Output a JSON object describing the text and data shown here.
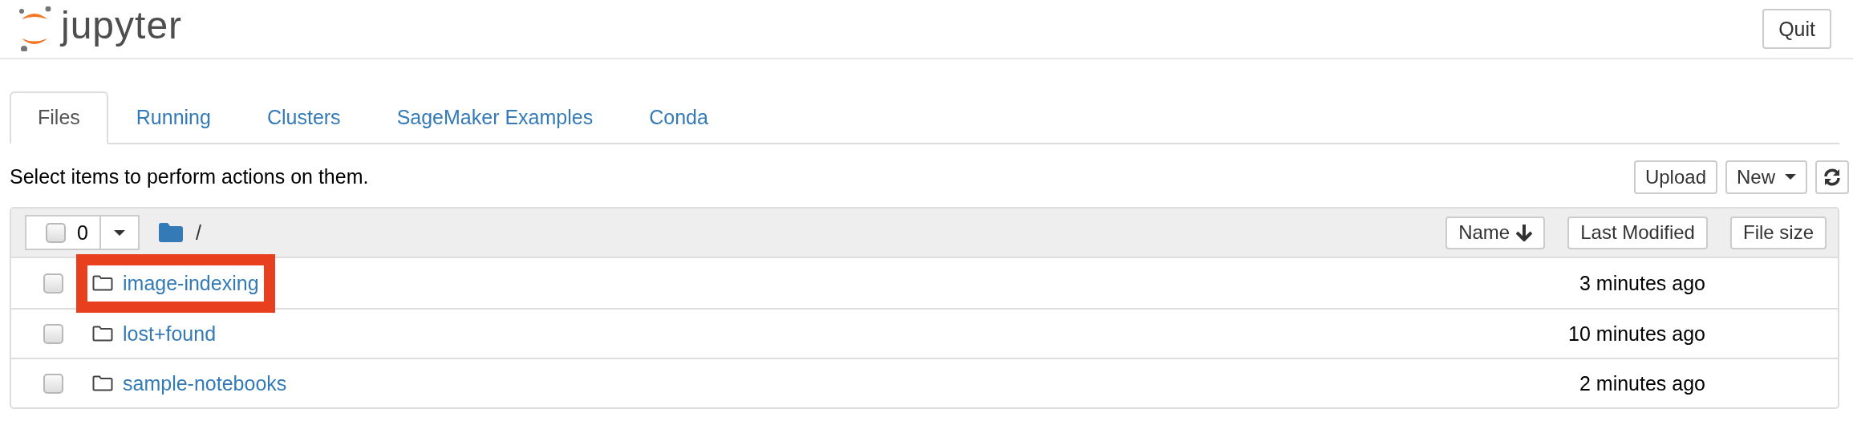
{
  "header": {
    "logo_text": "jupyter",
    "quit_button": "Quit"
  },
  "tabs": [
    {
      "label": "Files",
      "selected": true
    },
    {
      "label": "Running",
      "selected": false
    },
    {
      "label": "Clusters",
      "selected": false
    },
    {
      "label": "SageMaker Examples",
      "selected": false
    },
    {
      "label": "Conda",
      "selected": false
    }
  ],
  "toolbar": {
    "hint": "Select items to perform actions on them.",
    "buttons": [
      {
        "kind": "plain",
        "label": "Upload"
      },
      {
        "kind": "dropdown",
        "label": "New"
      },
      {
        "kind": "refresh"
      }
    ]
  },
  "file_list": {
    "select_all": {
      "checked": false,
      "count": "0"
    },
    "path": "/",
    "columns": [
      {
        "label": "Name",
        "sorted": true
      },
      {
        "label": "Last Modified",
        "sorted": false
      },
      {
        "label": "File size",
        "sorted": false
      }
    ],
    "rows": [
      {
        "name": "image-indexing",
        "modified": "3 minutes ago",
        "checked": false,
        "highlighted": true
      },
      {
        "name": "lost+found",
        "modified": "10 minutes ago",
        "checked": false,
        "highlighted": false
      },
      {
        "name": "sample-notebooks",
        "modified": "2 minutes ago",
        "checked": false,
        "highlighted": false
      }
    ]
  }
}
